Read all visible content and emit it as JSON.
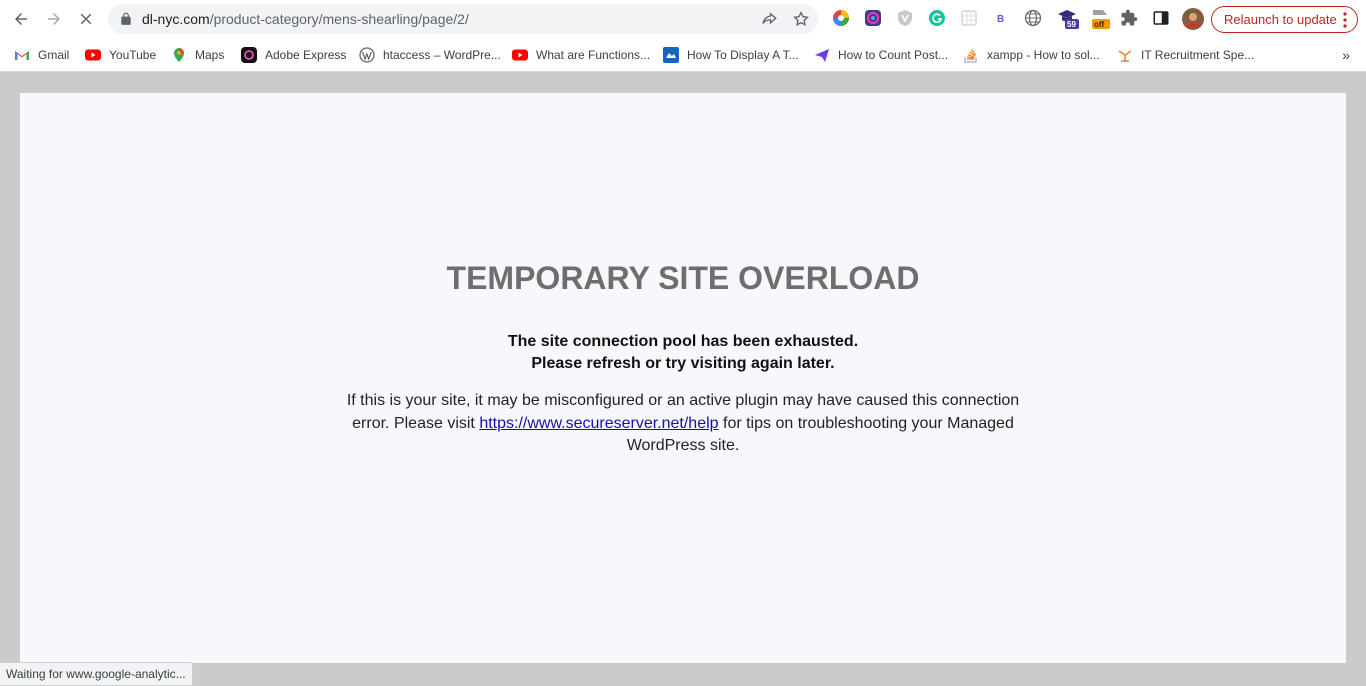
{
  "browser": {
    "url_host": "dl-nyc.com",
    "url_path": "/product-category/mens-shearling/page/2/",
    "relaunch_label": "Relaunch to update",
    "extension_badge_count": "59",
    "extension_badge_off": "off",
    "accent_color": "#c5221f"
  },
  "bookmarks": [
    {
      "label": "Gmail",
      "icon": "gmail-icon"
    },
    {
      "label": "YouTube",
      "icon": "youtube-icon"
    },
    {
      "label": "Maps",
      "icon": "maps-icon"
    },
    {
      "label": "Adobe Express",
      "icon": "adobe-express-icon"
    },
    {
      "label": "htaccess – WordPre...",
      "icon": "wordpress-icon"
    },
    {
      "label": "What are Functions...",
      "icon": "youtube-icon"
    },
    {
      "label": "How To Display A T...",
      "icon": "site-icon"
    },
    {
      "label": "How to Count Post...",
      "icon": "paper-plane-icon"
    },
    {
      "label": "xampp - How to sol...",
      "icon": "stackoverflow-icon"
    },
    {
      "label": "IT Recruitment Spe...",
      "icon": "recruit-icon"
    }
  ],
  "page": {
    "title": "TEMPORARY SITE OVERLOAD",
    "bold_line_1": "The site connection pool has been exhausted.",
    "bold_line_2": "Please refresh or try visiting again later.",
    "info_before_link": "If this is your site, it may be misconfigured or an active plugin may have caused this connection error. Please visit ",
    "info_link": "https://www.secureserver.net/help",
    "info_after_link": " for tips on troubleshooting your Managed WordPress site."
  },
  "status_bar": {
    "text": "Waiting for www.google-analytic..."
  }
}
